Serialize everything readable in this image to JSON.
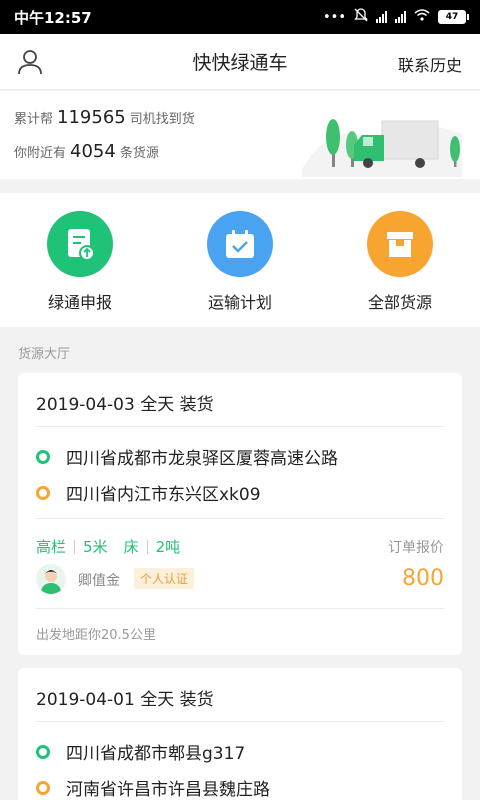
{
  "status_bar": {
    "time": "中午12:57",
    "battery": "47"
  },
  "header": {
    "title": "快快绿通车",
    "history_label": "联系历史"
  },
  "stats": {
    "line1_prefix": "累计帮",
    "line1_count": "119565",
    "line1_suffix": "司机找到货",
    "line2_prefix": "你附近有",
    "line2_count": "4054",
    "line2_suffix": "条货源"
  },
  "quick_actions": [
    {
      "label": "绿通申报",
      "icon": "document-upload-icon",
      "color": "#1fc276"
    },
    {
      "label": "运输计划",
      "icon": "calendar-check-icon",
      "color": "#4aa3f0"
    },
    {
      "label": "全部货源",
      "icon": "box-icon",
      "color": "#f8a431"
    }
  ],
  "section_title": "货源大厅",
  "cards": [
    {
      "date": "2019-04-03 全天 装货",
      "from": "四川省成都市龙泉驿区厦蓉高速公路",
      "to": "四川省内江市东兴区xk09",
      "truck_type": "高栏",
      "truck_length": "5米",
      "cargo_type": "床",
      "weight": "2吨",
      "price_label": "订单报价",
      "price": "800",
      "poster": "卿值金",
      "cert": "个人认证",
      "distance": "出发地距你20.5公里"
    },
    {
      "date": "2019-04-01 全天 装货",
      "from": "四川省成都市郫县g317",
      "to": "河南省许昌市许昌县魏庄路"
    }
  ],
  "colors": {
    "accent_green": "#1fc276",
    "accent_orange": "#f8a431",
    "accent_blue": "#4aa3f0"
  }
}
